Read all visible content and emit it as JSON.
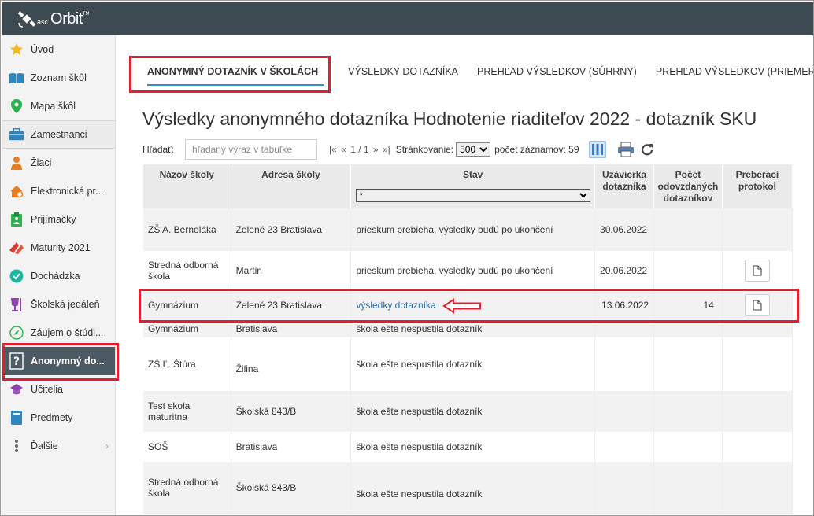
{
  "app": {
    "logo_prefix": "asc",
    "logo_name": "Orbit",
    "logo_tm": "TM"
  },
  "sidebar": {
    "items": [
      {
        "label": "Úvod",
        "icon": "star-icon"
      },
      {
        "label": "Zoznam škôl",
        "icon": "book-icon"
      },
      {
        "label": "Mapa škôl",
        "icon": "map-pin-icon"
      },
      {
        "label": "Zamestnanci",
        "icon": "briefcase-icon"
      },
      {
        "label": "Žiaci",
        "icon": "student-icon"
      },
      {
        "label": "Elektronická pr...",
        "icon": "home-gear-icon"
      },
      {
        "label": "Prijímačky",
        "icon": "clipboard-icon"
      },
      {
        "label": "Maturity 2021",
        "icon": "maturity-icon"
      },
      {
        "label": "Dochádzka",
        "icon": "check-circle-icon"
      },
      {
        "label": "Školská jedáleň",
        "icon": "cup-icon"
      },
      {
        "label": "Záujem o štúdi...",
        "icon": "compass-icon"
      },
      {
        "label": "Anonymný do...",
        "icon": "question-icon"
      },
      {
        "label": "Učitelia",
        "icon": "graduation-cap-icon"
      },
      {
        "label": "Predmety",
        "icon": "notebook-icon"
      },
      {
        "label": "Ďalšie",
        "icon": "more-dots-icon"
      }
    ]
  },
  "tabs": [
    {
      "label": "ANONYMNÝ DOTAZNÍK V ŠKOLÁCH",
      "active": true
    },
    {
      "label": "VÝSLEDKY DOTAZNÍKA"
    },
    {
      "label": "PREHĽAD VÝSLEDKOV (SÚHRNY)"
    },
    {
      "label": "PREHĽAD VÝSLEDKOV (PRIEMERY)"
    }
  ],
  "page_title": "Výsledky anonymného dotazníka Hodnotenie riaditeľov 2022 - dotazník SKU",
  "toolbar": {
    "search_label": "Hľadať:",
    "search_placeholder": "hľadaný výraz v tabuľke",
    "pager_first": "|«",
    "pager_prev": "«",
    "pager_text": "1 / 1",
    "pager_next": "»",
    "pager_last": "»|",
    "paging_label": "Stránkovanie:",
    "paging_value": "500",
    "count_text": "počet záznamov: 59"
  },
  "table": {
    "headers": {
      "school": "Názov školy",
      "address": "Adresa školy",
      "status": "Stav",
      "deadline": "Uzávierka dotazníka",
      "count": "Počet odovzdaných dotazníkov",
      "protocol": "Preberací protokol"
    },
    "status_filter": "*",
    "rows": [
      {
        "school": "ZŠ A. Bernoláka",
        "address": "Zelené 23 Bratislava",
        "status": "prieskum prebieha, výsledky budú po ukončení",
        "deadline": "30.06.2022",
        "count": ""
      },
      {
        "school": "Stredná odborná škola",
        "address": "Martin",
        "status": "prieskum prebieha, výsledky budú po ukončení",
        "deadline": "20.06.2022",
        "count": ""
      },
      {
        "school": "Gymnázium",
        "address": "Zelené 23 Bratislava",
        "status": "výsledky dotazníka",
        "deadline": "13.06.2022",
        "count": "14"
      },
      {
        "school": "Gymnázium",
        "address": "Bratislava",
        "status": "škola ešte nespustila dotazník",
        "deadline": "",
        "count": ""
      },
      {
        "school": "ZŠ Ľ. Štúra",
        "address": "Žilina",
        "status": "škola ešte nespustila dotazník",
        "deadline": "",
        "count": ""
      },
      {
        "school": "Test skola maturitna",
        "address": "Školská 843/B",
        "status": "škola ešte nespustila dotazník",
        "deadline": "",
        "count": ""
      },
      {
        "school": "SOŠ",
        "address": "Bratislava",
        "status": "škola ešte nespustila dotazník",
        "deadline": "",
        "count": ""
      },
      {
        "school": "Stredná odborná škola",
        "address": "Školská 843/B",
        "status": "škola ešte nespustila dotazník",
        "deadline": "",
        "count": ""
      }
    ]
  },
  "colors": {
    "topbar": "#3e4a52",
    "active_sidebar": "#4c5a64",
    "highlight": "#e0202e",
    "link": "#2a6fb0"
  }
}
